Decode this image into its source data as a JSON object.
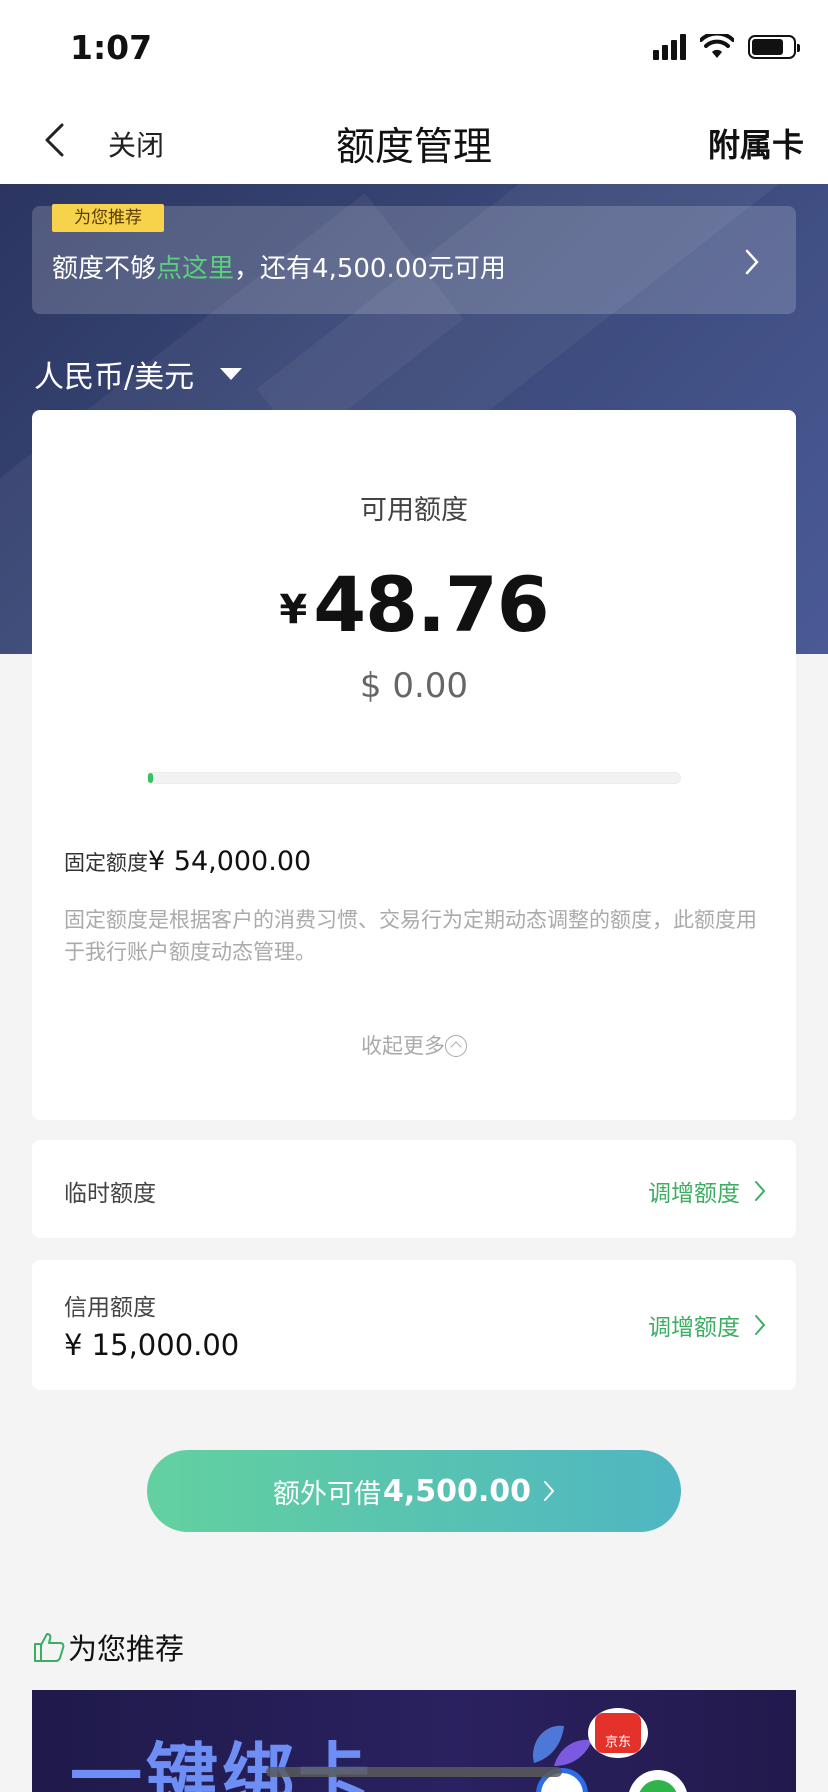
{
  "status_bar": {
    "time": "1:07"
  },
  "nav": {
    "close_label": "关闭",
    "title": "额度管理",
    "right_label": "附属卡"
  },
  "promo": {
    "tag": "为您推荐",
    "text_prefix": "额度不够",
    "text_highlight": "点这里",
    "text_suffix": "，还有4,500.00元可用"
  },
  "currency_selector": {
    "label": "人民币/美元"
  },
  "available": {
    "label": "可用额度",
    "currency_symbol": "¥",
    "amount": "48.76",
    "usd_amount": "$ 0.00",
    "usage_fraction": 0.005
  },
  "fixed_limit": {
    "label": "固定额度",
    "amount": "¥ 54,000.00",
    "description": "固定额度是根据客户的消费习惯、交易行为定期动态调整的额度，此额度用于我行账户额度动态管理。",
    "collapse_label": "收起更多"
  },
  "temporary_limit": {
    "label": "临时额度",
    "action": "调增额度"
  },
  "credit_limit": {
    "label": "信用额度",
    "amount": "¥ 15,000.00",
    "action": "调增额度"
  },
  "borrow_button": {
    "prefix": "额外可借",
    "amount": "4,500.00"
  },
  "recommend": {
    "title": "为您推荐",
    "banner_text": "一键绑卡",
    "jd_label": "京东"
  },
  "colors": {
    "accent_green": "#3cae63",
    "hero_navy": "#3a4878",
    "tag_yellow": "#f6d34a"
  }
}
